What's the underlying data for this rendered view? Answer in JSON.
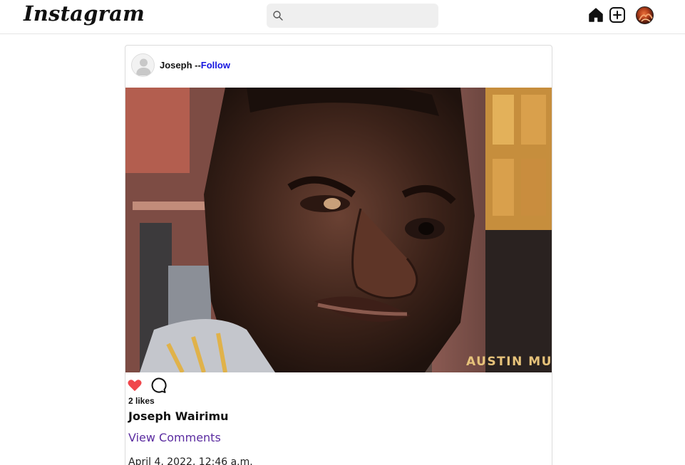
{
  "app": {
    "logo_text": "Instagram"
  },
  "header": {
    "search": {
      "placeholder": "",
      "value": "",
      "icon": "search-icon"
    },
    "nav_icons": [
      "home-icon",
      "add-post-icon",
      "profile-avatar"
    ]
  },
  "post": {
    "author": {
      "username": "Joseph",
      "separator": " --",
      "follow_label": "Follow"
    },
    "image": {
      "watermark": "AUSTIN MU"
    },
    "actions": {
      "like_icon": "heart-icon",
      "like_color": "#f0464b",
      "comment_icon": "comment-icon"
    },
    "likes_text": "2 likes",
    "caption_name": "Joseph Wairimu",
    "view_comments_label": "View Comments",
    "timestamp": "April 4, 2022, 12:46 a.m."
  },
  "colors": {
    "follow_link": "#1515e0",
    "view_comments": "#5b2ca0"
  }
}
